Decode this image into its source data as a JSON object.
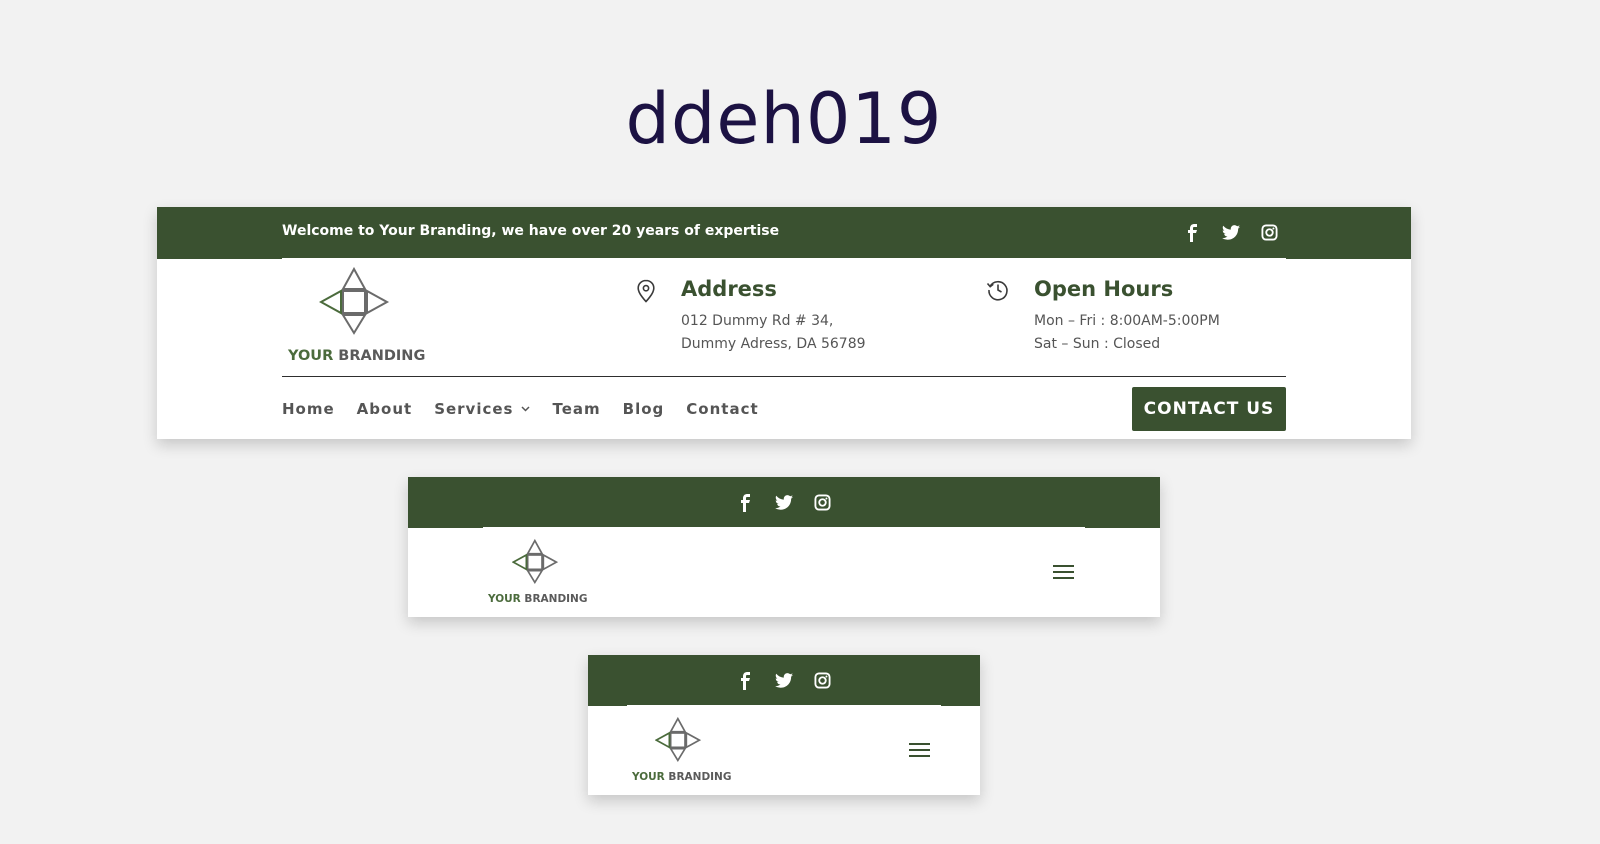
{
  "page_title": "ddeh019",
  "desktop": {
    "topbar_text": "Welcome to Your Branding, we have over 20 years of expertise",
    "logo": {
      "accent": "YOUR",
      "rest": " BRANDING"
    },
    "address": {
      "title": "Address",
      "line1": "012 Dummy Rd # 34,",
      "line2": "Dummy Adress, DA 56789"
    },
    "hours": {
      "title": "Open Hours",
      "line1": "Mon – Fri : 8:00AM-5:00PM",
      "line2": "Sat – Sun : Closed"
    },
    "nav": [
      "Home",
      "About",
      "Services",
      "Team",
      "Blog",
      "Contact"
    ],
    "cta": "CONTACT US"
  },
  "tablet": {
    "logo": {
      "accent": "YOUR",
      "rest": " BRANDING"
    }
  },
  "mobile": {
    "logo": {
      "accent": "YOUR",
      "rest": " BRANDING"
    }
  },
  "colors": {
    "brand_green": "#3a5130",
    "title_color": "#1c1243",
    "background": "#f2f2f2"
  },
  "icons": {
    "social": [
      "facebook-icon",
      "twitter-icon",
      "instagram-icon"
    ],
    "address": "map-pin-icon",
    "hours": "clock-history-icon",
    "menu": "hamburger-menu-icon"
  }
}
